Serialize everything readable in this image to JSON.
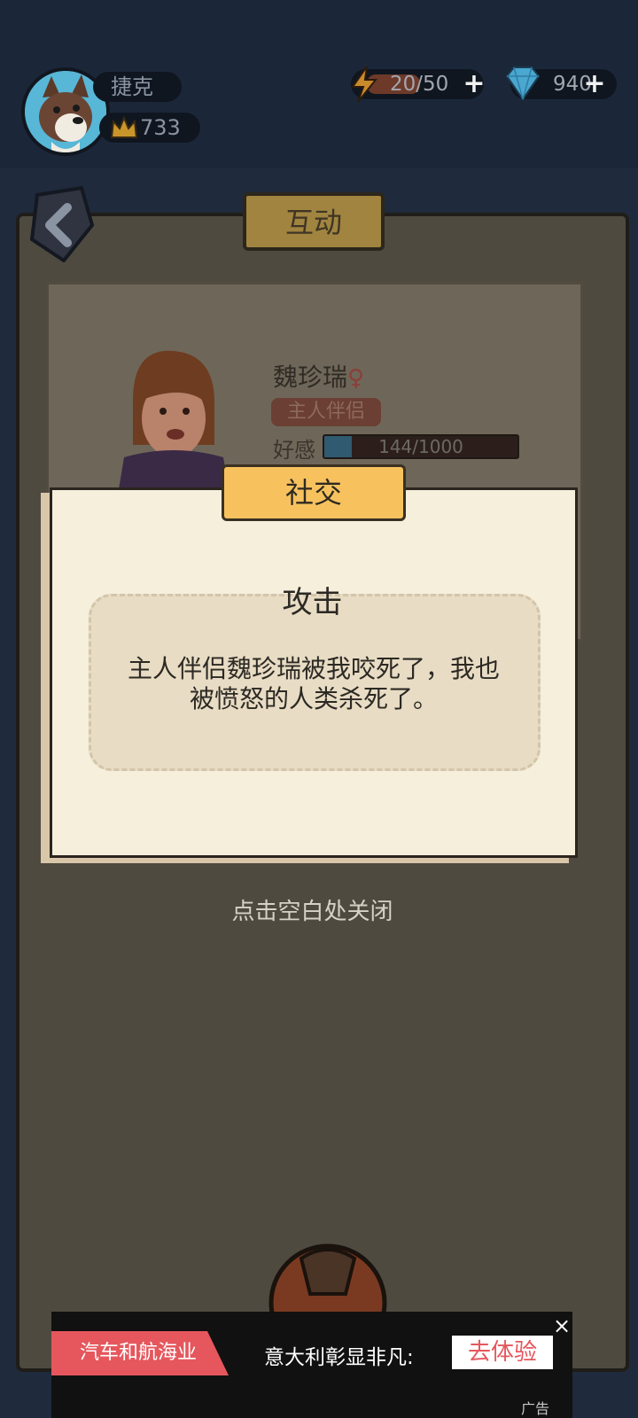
{
  "header": {
    "player_name": "捷克",
    "crown_score": "733",
    "energy": "20/50",
    "energy_fraction": 0.4,
    "gems": "940"
  },
  "screen": {
    "title": "互动"
  },
  "character": {
    "name": "魏珍瑞",
    "gender_symbol": "♀",
    "role": "主人伴侣",
    "favor_label": "好感",
    "favor_value": "144/1000",
    "favor_fraction": 0.144
  },
  "modal": {
    "banner": "社交",
    "heading": "攻击",
    "body": "主人伴侣魏珍瑞被我咬死了，我也被愤怒的人类杀死了。"
  },
  "close_hint": "点击空白处关闭",
  "ad": {
    "tag": "汽车和航海业",
    "text": "意大利彰显非凡:",
    "button": "去体验",
    "close": "×",
    "label": "广告"
  },
  "colors": {
    "accent_yellow": "#f7c25e",
    "ad_red": "#e5575d",
    "panel_bg": "#f6efdc"
  }
}
